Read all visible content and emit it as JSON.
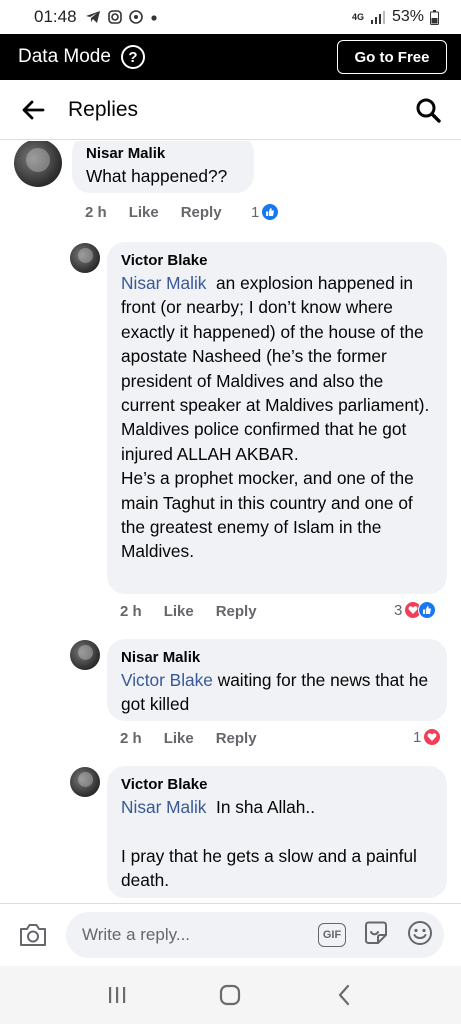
{
  "status_bar": {
    "time": "01:48",
    "network": "4G",
    "battery": "53%"
  },
  "data_bar": {
    "label": "Data Mode",
    "help_symbol": "?",
    "go_free_label": "Go to Free"
  },
  "header": {
    "title": "Replies",
    "back_icon": "back-arrow-icon",
    "search_icon": "search-icon"
  },
  "comments": [
    {
      "author": "Nisar Malik",
      "text": "What happened??",
      "time": "2 h",
      "like_label": "Like",
      "reply_label": "Reply",
      "reaction_count": "1",
      "reactions": [
        "like"
      ]
    },
    {
      "author": "Victor Blake",
      "mention": "Nisar Malik",
      "text": "  an explosion happened in front (or nearby; I don’t know where exactly it happened) of the house of the apostate Nasheed (he’s the former president of Maldives and also the current speaker at Maldives parliament).\nMaldives police confirmed that he got injured ALLAH AKBAR.\nHe’s a prophet mocker, and one of the main Taghut in this country and one of the greatest enemy of Islam in the Maldives.",
      "time": "2 h",
      "like_label": "Like",
      "reply_label": "Reply",
      "reaction_count": "3",
      "reactions": [
        "love",
        "like"
      ]
    },
    {
      "author": "Nisar Malik",
      "mention": "Victor Blake",
      "text": " waiting for the news that he got killed",
      "time": "2 h",
      "like_label": "Like",
      "reply_label": "Reply",
      "reaction_count": "1",
      "reactions": [
        "love"
      ]
    },
    {
      "author": "Victor Blake",
      "mention": "Nisar Malik",
      "text": "  In sha Allah..\n\nI pray that he gets a slow and a painful death.",
      "time": "",
      "like_label": "",
      "reply_label": "",
      "reaction_count": "",
      "reactions": []
    }
  ],
  "reply_bar": {
    "placeholder": "Write a reply...",
    "gif_label": "GIF",
    "camera_icon": "camera-icon",
    "sticker_icon": "sticker-icon",
    "emoji_icon": "emoji-icon"
  },
  "nav_bar": {
    "recents_icon": "recents-icon",
    "home_icon": "home-icon",
    "back_icon": "nav-back-icon"
  },
  "colors": {
    "link": "#385898",
    "bubble": "#f0f2f5",
    "like": "#1877f2",
    "love": "#f33e58",
    "secondary_text": "#65676b"
  }
}
